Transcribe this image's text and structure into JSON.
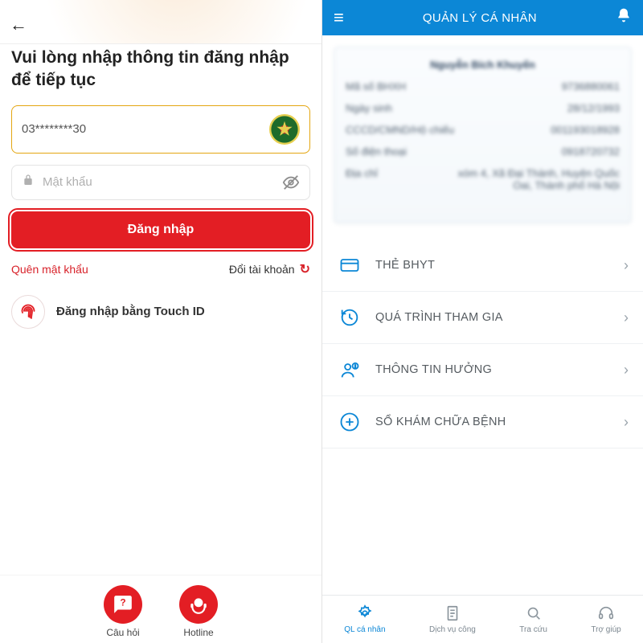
{
  "left": {
    "title": "Vui lòng nhập thông tin đăng nhập để tiếp tục",
    "phone_value": "03********30",
    "password_placeholder": "Mật khẩu",
    "login_label": "Đăng nhập",
    "forgot_label": "Quên mật khẩu",
    "switch_account_label": "Đổi tài khoản",
    "touch_id_label": "Đăng nhập bằng Touch ID",
    "faq_label": "Câu hỏi",
    "hotline_label": "Hotline"
  },
  "right": {
    "header_title": "QUẢN LÝ CÁ NHÂN",
    "card": {
      "name": "Nguyễn Bích Khuyến",
      "code_label": "Mã số BHXH",
      "code": "9736880061",
      "dob_label": "Ngày sinh",
      "dob": "28/12/1993",
      "cccd_label": "CCCD/CMND/Hộ chiếu",
      "cccd": "001193018928",
      "phone_label": "Số điện thoại",
      "phone": "0918720732",
      "addr_label": "Địa chỉ",
      "addr": "xóm 4, Xã Đại Thành, Huyện Quốc Oai, Thành phố Hà Nội"
    },
    "menu": [
      "THẺ BHYT",
      "QUÁ TRÌNH THAM GIA",
      "THÔNG TIN HƯỞNG",
      "SỔ KHÁM CHỮA BỆNH"
    ],
    "tabs": [
      "QL cá nhân",
      "Dịch vụ công",
      "Tra cứu",
      "Trợ giúp"
    ]
  }
}
